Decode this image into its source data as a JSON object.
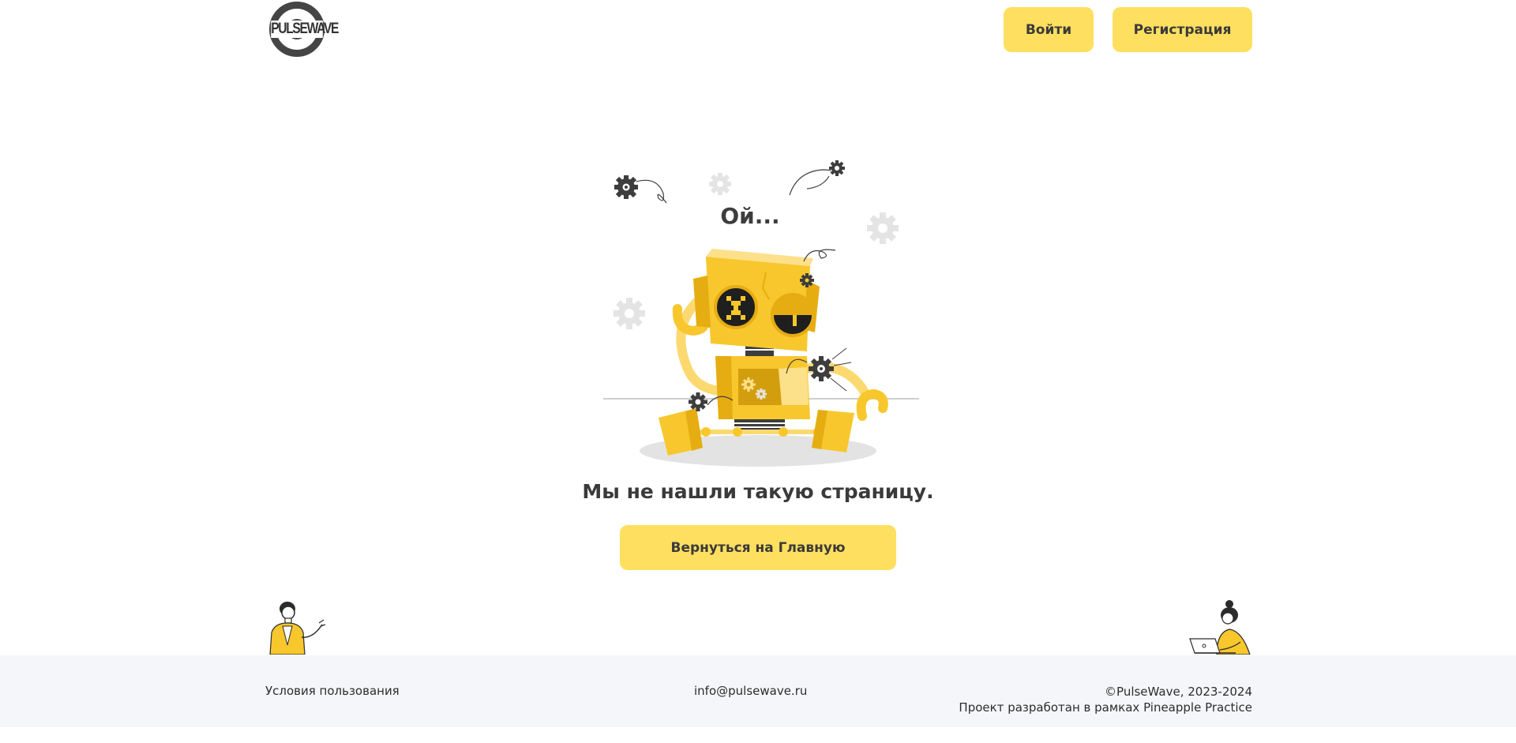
{
  "header": {
    "logo_text": "PULSEWAVE",
    "login_label": "Войти",
    "register_label": "Регистрация"
  },
  "error": {
    "title": "Ой...",
    "message": "Мы не нашли такую страницу.",
    "home_button_label": "Вернуться на Главную"
  },
  "footer": {
    "terms_label": "Условия пользования",
    "email": "info@pulsewave.ru",
    "copyright": "©PulseWave, 2023-2024",
    "credits": "Проект разработан в рамках Pineapple Practice"
  },
  "colors": {
    "accent": "#ffdf5f",
    "robot_yellow": "#f7c72d",
    "text": "#3a3a3a",
    "footer_bg": "#f5f6f9"
  },
  "icons": [
    "gear-icon",
    "broken-robot-illustration",
    "person-waving-illustration",
    "person-laptop-illustration"
  ]
}
